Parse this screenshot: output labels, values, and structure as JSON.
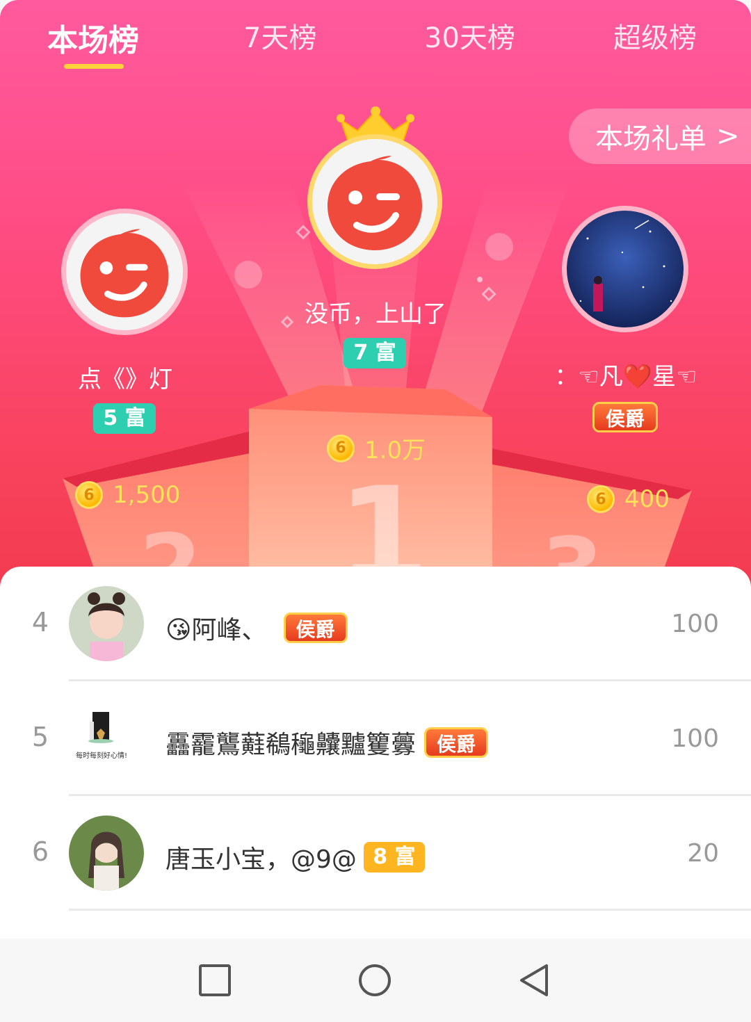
{
  "tabs": [
    {
      "label": "本场榜",
      "active": true
    },
    {
      "label": "7天榜",
      "active": false
    },
    {
      "label": "30天榜",
      "active": false
    },
    {
      "label": "超级榜",
      "active": false
    }
  ],
  "gift_list_button": {
    "label": "本场礼单",
    "chevron": ">"
  },
  "podium": {
    "first": {
      "rank": 1,
      "name": "没币，上山了",
      "badge": "7 富",
      "coins": "1.0万"
    },
    "second": {
      "rank": 2,
      "name": "点《》灯",
      "badge": "5 富",
      "coins": "1,500"
    },
    "third": {
      "rank": 3,
      "name": "：☜凡❤️星☜",
      "badge": "侯爵",
      "coins": "400"
    }
  },
  "list": [
    {
      "rank": "4",
      "name": "😘阿峰、",
      "badge": "侯爵",
      "score": "100"
    },
    {
      "rank": "5",
      "name": "靐靇鸗蘳鵗龝齉黸籰虋",
      "badge": "侯爵",
      "score": "100",
      "avatar_caption": "每时每刻好心情!"
    },
    {
      "rank": "6",
      "name": "唐玉小宝，@9@",
      "badge": "8 富",
      "score": "20"
    }
  ],
  "coin_glyph": "6",
  "podium_numbers": [
    "2",
    "1",
    "3"
  ],
  "colors": {
    "header_top": "#ff5a9e",
    "header_bottom": "#f23b4e",
    "rich_badge": "#2ecfb1",
    "rich_badge_gold": "#ffb51f",
    "tab_indicator": "#ffd23c",
    "coin_text": "#ffe15a"
  },
  "nav": [
    "square-icon",
    "circle-icon",
    "back-triangle-icon"
  ]
}
